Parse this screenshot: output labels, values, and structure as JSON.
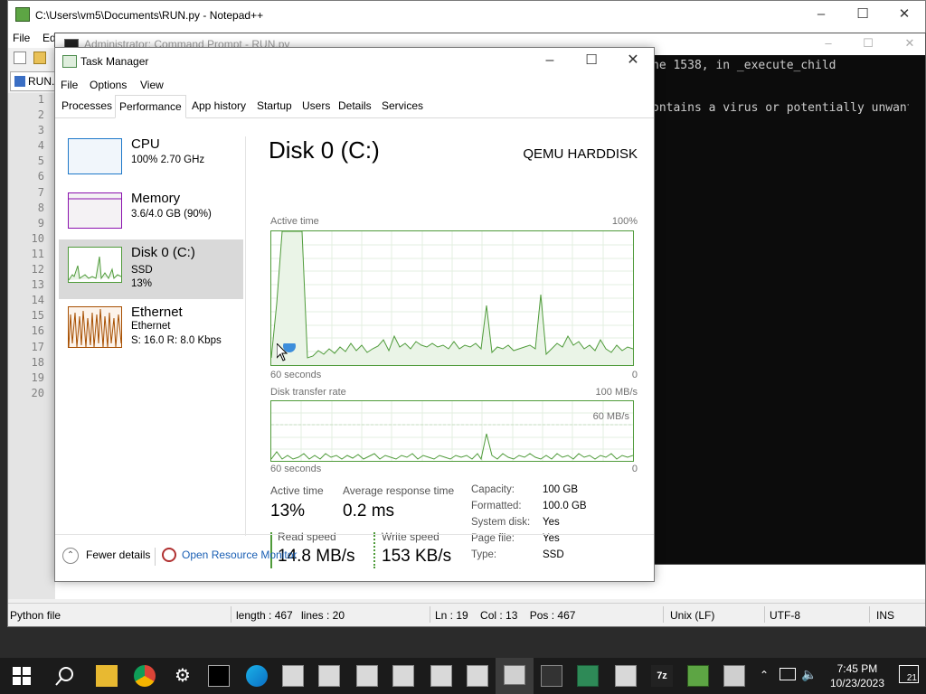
{
  "notepadpp": {
    "title": "C:\\Users\\vm5\\Documents\\RUN.py - Notepad++",
    "menu": [
      "File",
      "Edi"
    ],
    "tab_label": "RUN.",
    "line_numbers": [
      "1",
      "2",
      "3",
      "4",
      "5",
      "6",
      "7",
      "8",
      "9",
      "10",
      "11",
      "12",
      "13",
      "14",
      "15",
      "16",
      "17",
      "18",
      "19",
      "20"
    ],
    "status": {
      "file_type": "Python file",
      "length": "length : 467",
      "lines": "lines : 20",
      "position": "Ln : 19    Col : 13    Pos : 467",
      "eol": "Unix (LF)",
      "encoding": "UTF-8",
      "mode": "INS"
    }
  },
  "cmd": {
    "title": "Administrator: Command Prompt - RUN.py",
    "lines": [
      "ne 1538, in _execute_child",
      "ontains a virus or potentially unwante"
    ]
  },
  "taskmanager": {
    "title": "Task Manager",
    "menu": [
      "File",
      "Options",
      "View"
    ],
    "tabs": [
      "Processes",
      "Performance",
      "App history",
      "Startup",
      "Users",
      "Details",
      "Services"
    ],
    "active_tab": "Performance",
    "resources": [
      {
        "name": "CPU",
        "line1": "100%  2.70 GHz",
        "line2": ""
      },
      {
        "name": "Memory",
        "line1": "3.6/4.0 GB (90%)",
        "line2": ""
      },
      {
        "name": "Disk 0 (C:)",
        "line1": "SSD",
        "line2": "13%"
      },
      {
        "name": "Ethernet",
        "line1": "Ethernet",
        "line2": "S: 16.0  R: 8.0 Kbps"
      }
    ],
    "selected_resource": "Disk 0 (C:)",
    "detail": {
      "heading": "Disk 0 (C:)",
      "model": "QEMU HARDDISK",
      "graph1_label": "Active time",
      "graph1_max": "100%",
      "graph1_time": "60 seconds",
      "graph1_zero": "0",
      "graph2_label": "Disk transfer rate",
      "graph2_max": "100 MB/s",
      "graph2_mid": "60 MB/s",
      "graph2_time": "60 seconds",
      "graph2_zero": "0",
      "active_time_label": "Active time",
      "active_time_value": "13%",
      "avg_response_label": "Average response time",
      "avg_response_value": "0.2 ms",
      "read_speed_label": "Read speed",
      "read_speed_value": "14.8 MB/s",
      "write_speed_label": "Write speed",
      "write_speed_value": "153 KB/s",
      "properties": [
        {
          "label": "Capacity:",
          "value": "100 GB"
        },
        {
          "label": "Formatted:",
          "value": "100.0 GB"
        },
        {
          "label": "System disk:",
          "value": "Yes"
        },
        {
          "label": "Page file:",
          "value": "Yes"
        },
        {
          "label": "Type:",
          "value": "SSD"
        }
      ]
    },
    "footer": {
      "fewer_details": "Fewer details",
      "open_resource_monitor": "Open Resource Monitor"
    }
  },
  "taskbar": {
    "time": "7:45 PM",
    "date": "10/23/2023",
    "notification_count": "21"
  },
  "colors": {
    "disk_green": "#4f9b3a",
    "cpu_blue": "#1d78c9",
    "memory_purple": "#8b12ae",
    "ethernet_orange": "#a74f01",
    "taskbar": "#1b1b1b"
  }
}
